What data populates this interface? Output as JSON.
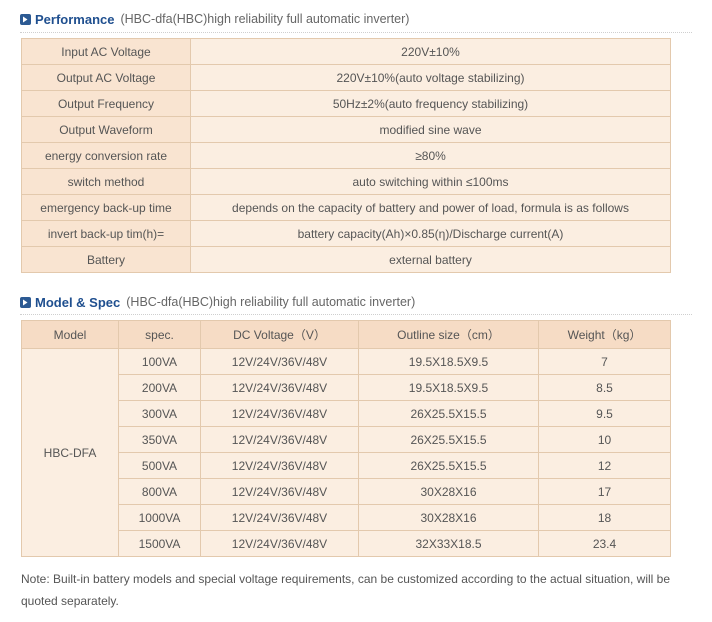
{
  "performance": {
    "title": "Performance",
    "subtitle": "(HBC-dfa(HBC)high reliability full automatic inverter)",
    "rows": [
      {
        "label": "Input AC Voltage",
        "value": "220V±10%"
      },
      {
        "label": "Output AC Voltage",
        "value": "220V±10%(auto voltage stabilizing)"
      },
      {
        "label": "Output Frequency",
        "value": "50Hz±2%(auto frequency stabilizing)"
      },
      {
        "label": "Output Waveform",
        "value": "modified sine wave"
      },
      {
        "label": "energy conversion rate",
        "value": "≥80%"
      },
      {
        "label": "switch method",
        "value": "auto switching within ≤100ms"
      },
      {
        "label": "emergency back-up time",
        "value": "depends on the capacity of battery and power of load, formula is as follows"
      },
      {
        "label": "invert back-up tim(h)=",
        "value": "battery capacity(Ah)×0.85(η)/Discharge current(A)"
      },
      {
        "label": "Battery",
        "value": "external battery"
      }
    ]
  },
  "model_spec": {
    "title": "Model & Spec",
    "subtitle": "(HBC-dfa(HBC)high reliability full automatic inverter)",
    "headers": [
      "Model",
      "spec.",
      "DC Voltage（V）",
      "Outline size（cm）",
      "Weight（kg）"
    ],
    "model": "HBC-DFA",
    "rows": [
      {
        "spec": "100VA",
        "dc": "12V/24V/36V/48V",
        "size": "19.5X18.5X9.5",
        "weight": "7"
      },
      {
        "spec": "200VA",
        "dc": "12V/24V/36V/48V",
        "size": "19.5X18.5X9.5",
        "weight": "8.5"
      },
      {
        "spec": "300VA",
        "dc": "12V/24V/36V/48V",
        "size": "26X25.5X15.5",
        "weight": "9.5"
      },
      {
        "spec": "350VA",
        "dc": "12V/24V/36V/48V",
        "size": "26X25.5X15.5",
        "weight": "10"
      },
      {
        "spec": "500VA",
        "dc": "12V/24V/36V/48V",
        "size": "26X25.5X15.5",
        "weight": "12"
      },
      {
        "spec": "800VA",
        "dc": "12V/24V/36V/48V",
        "size": "30X28X16",
        "weight": "17"
      },
      {
        "spec": "1000VA",
        "dc": "12V/24V/36V/48V",
        "size": "30X28X16",
        "weight": "18"
      },
      {
        "spec": "1500VA",
        "dc": "12V/24V/36V/48V",
        "size": "32X33X18.5",
        "weight": "23.4"
      }
    ]
  },
  "note": "Note: Built-in battery models and special voltage requirements, can be customized according to the actual situation, will be quoted separately.",
  "colors": {
    "heading": "#1f4f8f",
    "bullet": "#2c5a93",
    "label_bg": "#f9e4d1",
    "cell_bg": "#fbeee1",
    "border": "#e3c9ad"
  },
  "icons": {
    "section_bullet": "chevron-right-icon"
  }
}
